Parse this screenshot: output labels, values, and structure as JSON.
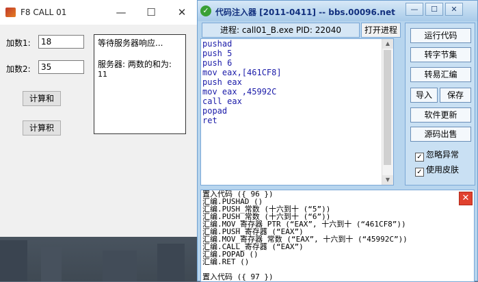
{
  "left_window": {
    "title": "F8 CALL 01",
    "label1": "加数1:",
    "input1": "18",
    "label2": "加数2:",
    "input2": "35",
    "btn_sum": "计算和",
    "btn_product": "计算积",
    "msg_line1": "等待服务器响应...",
    "msg_line2": "服务器: 两数的和为:",
    "msg_line3": "11"
  },
  "right_window": {
    "title": "代码注入器 [2011-0411]  -- bbs.00096.net",
    "process_info": "进程: call01_B.exe  PID: 22040",
    "open_process": "打开进程",
    "code_lines": [
      "pushad",
      "push 5",
      "push 6",
      "mov eax,[461CF8]",
      "push eax",
      "mov eax ,45992C",
      "call eax",
      "popad",
      "ret"
    ],
    "side_buttons": {
      "run": "运行代码",
      "to_bytes": "转字节集",
      "to_easy": "转易汇编",
      "import": "导入",
      "save": "保存",
      "update": "软件更新",
      "sell": "源码出售"
    },
    "checks": {
      "ignore": "忽略异常",
      "skin": "使用皮肤"
    },
    "output_lines": [
      "置入代码 ({ 96 })",
      "汇编.PUSHAD ()",
      "汇编.PUSH_常数 (十六到十 (“5”))",
      "汇编.PUSH_常数 (十六到十 (“6”))",
      "汇编.MOV_寄存器_PTR (“EAX”, 十六到十 (“461CF8”))",
      "汇编.PUSH_寄存器 (“EAX”)",
      "汇编.MOV_寄存器_常数 (“EAX”, 十六到十 (“45992C”))",
      "汇编.CALL_寄存器 (“EAX”)",
      "汇编.POPAD ()",
      "汇编.RET ()",
      "",
      "置入代码 ({ 97 })"
    ]
  }
}
